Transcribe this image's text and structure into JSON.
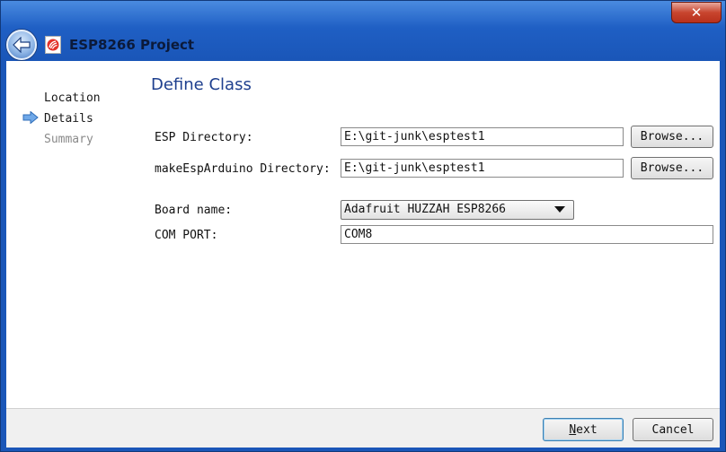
{
  "window": {
    "title": "ESP8266 Project",
    "close_label": "✕",
    "accent": "#1f5fc4"
  },
  "nav": {
    "items": [
      {
        "label": "Location",
        "state": "done"
      },
      {
        "label": "Details",
        "state": "current"
      },
      {
        "label": "Summary",
        "state": "disabled"
      }
    ],
    "current_icon": "right-arrow-icon"
  },
  "page": {
    "title": "Define Class"
  },
  "form": {
    "esp_dir": {
      "label": "ESP Directory:",
      "value": "E:\\git-junk\\esptest1",
      "browse": "Browse..."
    },
    "make_dir": {
      "label": "makeEspArduino Directory:",
      "value": "E:\\git-junk\\esptest1",
      "browse": "Browse..."
    },
    "board": {
      "label": "Board name:",
      "value": "Adafruit HUZZAH ESP8266"
    },
    "com_port": {
      "label": "COM PORT:",
      "value": "COM8"
    }
  },
  "footer": {
    "next_first": "N",
    "next_rest": "ext",
    "cancel": "Cancel"
  }
}
